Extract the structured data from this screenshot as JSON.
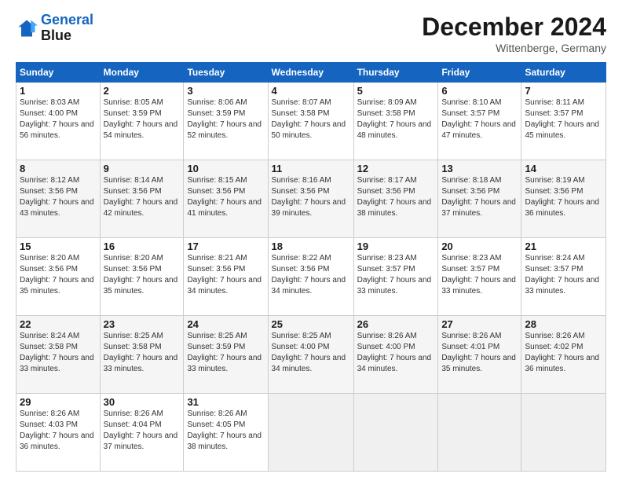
{
  "logo": {
    "line1": "General",
    "line2": "Blue"
  },
  "header": {
    "month": "December 2024",
    "location": "Wittenberge, Germany"
  },
  "weekdays": [
    "Sunday",
    "Monday",
    "Tuesday",
    "Wednesday",
    "Thursday",
    "Friday",
    "Saturday"
  ],
  "weeks": [
    [
      {
        "day": "1",
        "sunrise": "8:03 AM",
        "sunset": "4:00 PM",
        "daylight": "7 hours and 56 minutes."
      },
      {
        "day": "2",
        "sunrise": "8:05 AM",
        "sunset": "3:59 PM",
        "daylight": "7 hours and 54 minutes."
      },
      {
        "day": "3",
        "sunrise": "8:06 AM",
        "sunset": "3:59 PM",
        "daylight": "7 hours and 52 minutes."
      },
      {
        "day": "4",
        "sunrise": "8:07 AM",
        "sunset": "3:58 PM",
        "daylight": "7 hours and 50 minutes."
      },
      {
        "day": "5",
        "sunrise": "8:09 AM",
        "sunset": "3:58 PM",
        "daylight": "7 hours and 48 minutes."
      },
      {
        "day": "6",
        "sunrise": "8:10 AM",
        "sunset": "3:57 PM",
        "daylight": "7 hours and 47 minutes."
      },
      {
        "day": "7",
        "sunrise": "8:11 AM",
        "sunset": "3:57 PM",
        "daylight": "7 hours and 45 minutes."
      }
    ],
    [
      {
        "day": "8",
        "sunrise": "8:12 AM",
        "sunset": "3:56 PM",
        "daylight": "7 hours and 43 minutes."
      },
      {
        "day": "9",
        "sunrise": "8:14 AM",
        "sunset": "3:56 PM",
        "daylight": "7 hours and 42 minutes."
      },
      {
        "day": "10",
        "sunrise": "8:15 AM",
        "sunset": "3:56 PM",
        "daylight": "7 hours and 41 minutes."
      },
      {
        "day": "11",
        "sunrise": "8:16 AM",
        "sunset": "3:56 PM",
        "daylight": "7 hours and 39 minutes."
      },
      {
        "day": "12",
        "sunrise": "8:17 AM",
        "sunset": "3:56 PM",
        "daylight": "7 hours and 38 minutes."
      },
      {
        "day": "13",
        "sunrise": "8:18 AM",
        "sunset": "3:56 PM",
        "daylight": "7 hours and 37 minutes."
      },
      {
        "day": "14",
        "sunrise": "8:19 AM",
        "sunset": "3:56 PM",
        "daylight": "7 hours and 36 minutes."
      }
    ],
    [
      {
        "day": "15",
        "sunrise": "8:20 AM",
        "sunset": "3:56 PM",
        "daylight": "7 hours and 35 minutes."
      },
      {
        "day": "16",
        "sunrise": "8:20 AM",
        "sunset": "3:56 PM",
        "daylight": "7 hours and 35 minutes."
      },
      {
        "day": "17",
        "sunrise": "8:21 AM",
        "sunset": "3:56 PM",
        "daylight": "7 hours and 34 minutes."
      },
      {
        "day": "18",
        "sunrise": "8:22 AM",
        "sunset": "3:56 PM",
        "daylight": "7 hours and 34 minutes."
      },
      {
        "day": "19",
        "sunrise": "8:23 AM",
        "sunset": "3:57 PM",
        "daylight": "7 hours and 33 minutes."
      },
      {
        "day": "20",
        "sunrise": "8:23 AM",
        "sunset": "3:57 PM",
        "daylight": "7 hours and 33 minutes."
      },
      {
        "day": "21",
        "sunrise": "8:24 AM",
        "sunset": "3:57 PM",
        "daylight": "7 hours and 33 minutes."
      }
    ],
    [
      {
        "day": "22",
        "sunrise": "8:24 AM",
        "sunset": "3:58 PM",
        "daylight": "7 hours and 33 minutes."
      },
      {
        "day": "23",
        "sunrise": "8:25 AM",
        "sunset": "3:58 PM",
        "daylight": "7 hours and 33 minutes."
      },
      {
        "day": "24",
        "sunrise": "8:25 AM",
        "sunset": "3:59 PM",
        "daylight": "7 hours and 33 minutes."
      },
      {
        "day": "25",
        "sunrise": "8:25 AM",
        "sunset": "4:00 PM",
        "daylight": "7 hours and 34 minutes."
      },
      {
        "day": "26",
        "sunrise": "8:26 AM",
        "sunset": "4:00 PM",
        "daylight": "7 hours and 34 minutes."
      },
      {
        "day": "27",
        "sunrise": "8:26 AM",
        "sunset": "4:01 PM",
        "daylight": "7 hours and 35 minutes."
      },
      {
        "day": "28",
        "sunrise": "8:26 AM",
        "sunset": "4:02 PM",
        "daylight": "7 hours and 36 minutes."
      }
    ],
    [
      {
        "day": "29",
        "sunrise": "8:26 AM",
        "sunset": "4:03 PM",
        "daylight": "7 hours and 36 minutes."
      },
      {
        "day": "30",
        "sunrise": "8:26 AM",
        "sunset": "4:04 PM",
        "daylight": "7 hours and 37 minutes."
      },
      {
        "day": "31",
        "sunrise": "8:26 AM",
        "sunset": "4:05 PM",
        "daylight": "7 hours and 38 minutes."
      },
      null,
      null,
      null,
      null
    ]
  ]
}
